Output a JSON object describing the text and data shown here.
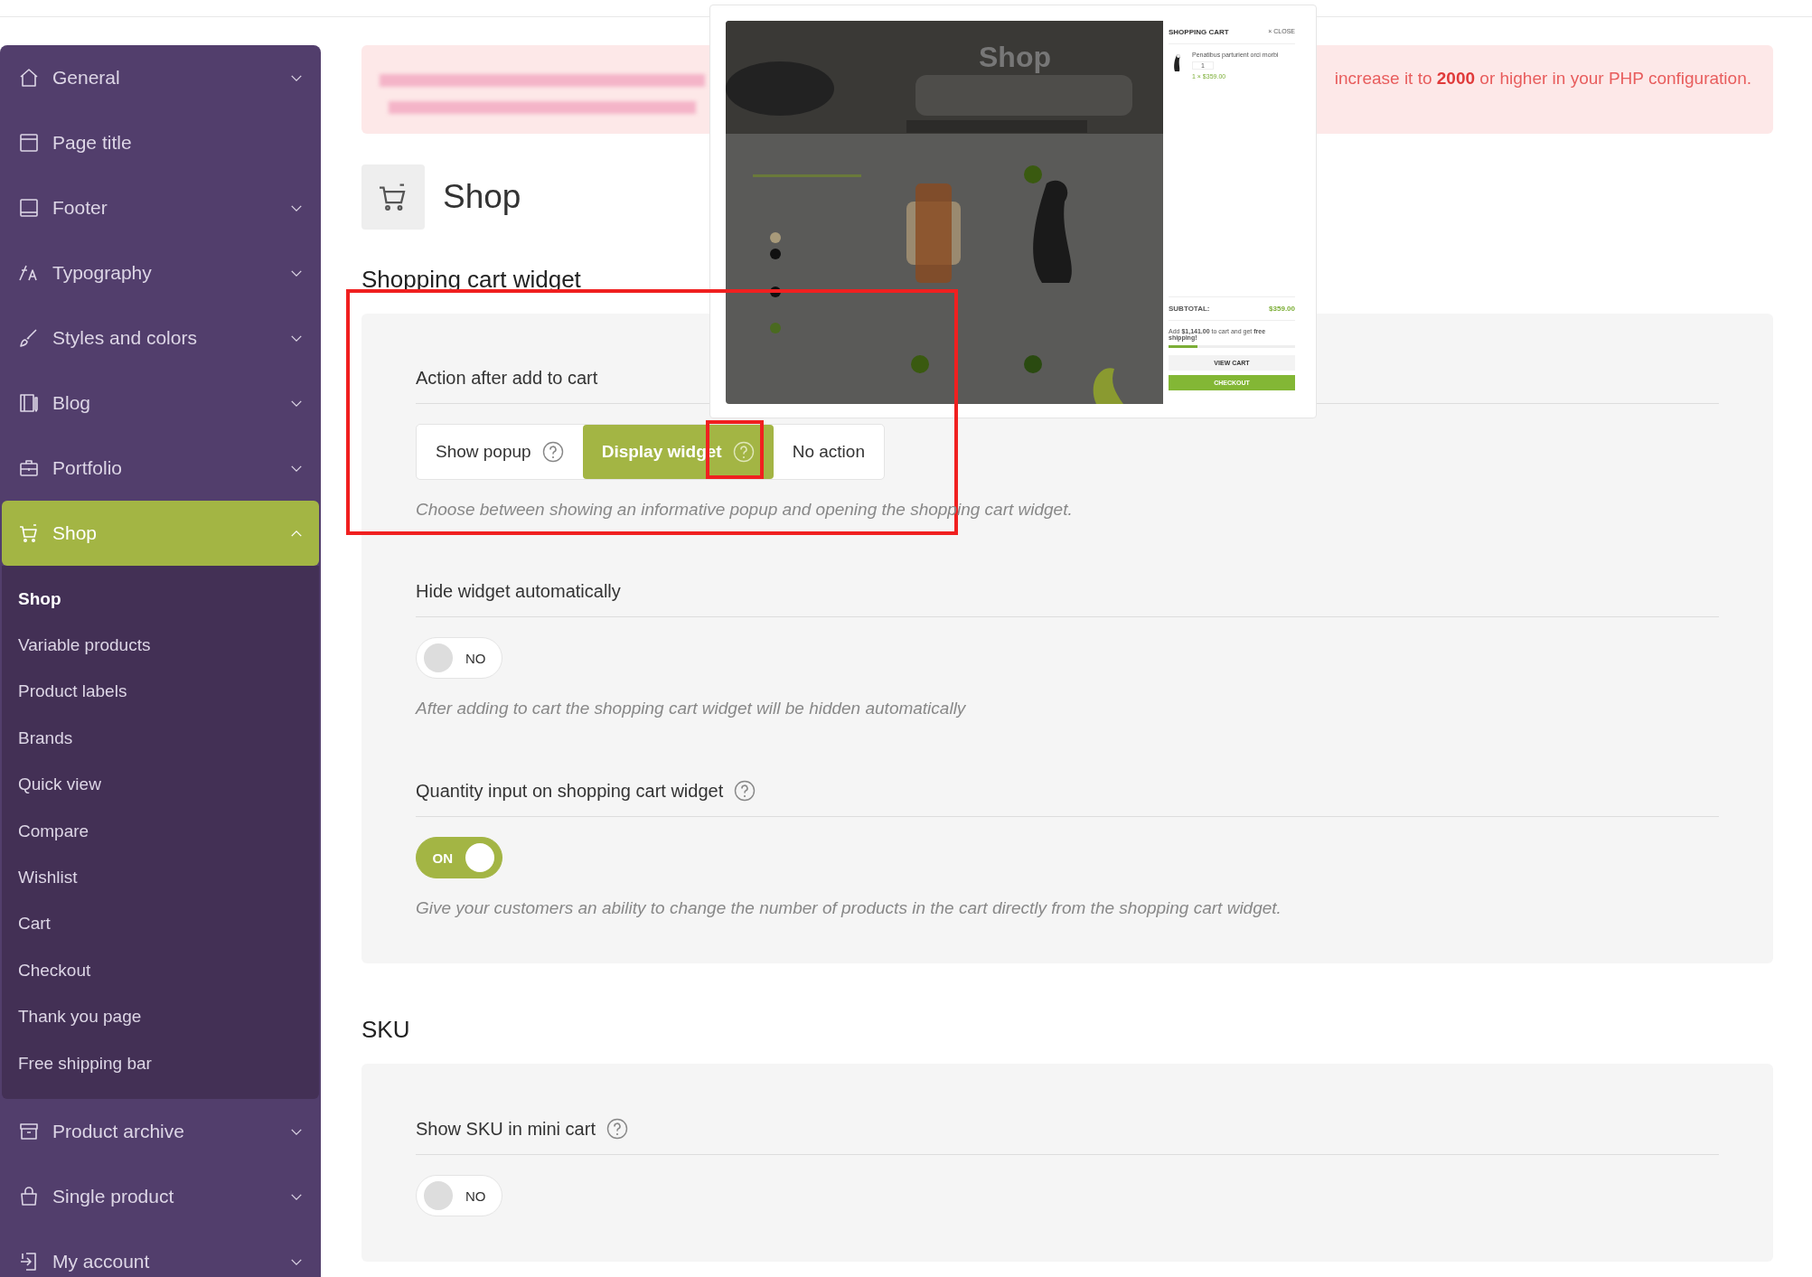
{
  "sidebar": {
    "items": [
      {
        "label": "General",
        "kind": "group",
        "expanded": false,
        "selected": false
      },
      {
        "label": "Page title",
        "kind": "link",
        "selected": false
      },
      {
        "label": "Footer",
        "kind": "group",
        "expanded": false,
        "selected": false
      },
      {
        "label": "Typography",
        "kind": "group",
        "expanded": false,
        "selected": false
      },
      {
        "label": "Styles and colors",
        "kind": "group",
        "expanded": false,
        "selected": false
      },
      {
        "label": "Blog",
        "kind": "group",
        "expanded": false,
        "selected": false
      },
      {
        "label": "Portfolio",
        "kind": "group",
        "expanded": false,
        "selected": false
      },
      {
        "label": "Shop",
        "kind": "group",
        "expanded": true,
        "selected": true,
        "children": [
          {
            "label": "Shop",
            "selected": true
          },
          {
            "label": "Variable products",
            "selected": false
          },
          {
            "label": "Product labels",
            "selected": false
          },
          {
            "label": "Brands",
            "selected": false
          },
          {
            "label": "Quick view",
            "selected": false
          },
          {
            "label": "Compare",
            "selected": false
          },
          {
            "label": "Wishlist",
            "selected": false
          },
          {
            "label": "Cart",
            "selected": false
          },
          {
            "label": "Checkout",
            "selected": false
          },
          {
            "label": "Thank you page",
            "selected": false
          },
          {
            "label": "Free shipping bar",
            "selected": false
          }
        ]
      },
      {
        "label": "Product archive",
        "kind": "group",
        "expanded": false,
        "selected": false
      },
      {
        "label": "Single product",
        "kind": "group",
        "expanded": false,
        "selected": false
      },
      {
        "label": "My account",
        "kind": "group",
        "expanded": false,
        "selected": false
      }
    ]
  },
  "notice": {
    "text": "increase it to **2000** or higher in your PHP configuration."
  },
  "page": {
    "title": "Shop"
  },
  "sections": [
    {
      "heading": "Shopping cart widget",
      "options": [
        {
          "kind": "segmented",
          "label": "Action after add to cart",
          "help": false,
          "choices": [
            {
              "label": "Show popup",
              "help": true,
              "selected": false
            },
            {
              "label": "Display widget",
              "help": true,
              "selected": true
            },
            {
              "label": "No action",
              "help": false,
              "selected": false
            }
          ],
          "description": "Choose between showing an informative popup and opening the shopping cart widget."
        },
        {
          "kind": "toggle",
          "label": "Hide widget automatically",
          "help": false,
          "on": false,
          "state_text": "NO",
          "description": "After adding to cart the shopping cart widget will be hidden automatically"
        },
        {
          "kind": "toggle",
          "label": "Quantity input on shopping cart widget",
          "help": true,
          "on": true,
          "state_text": "ON",
          "description": "Give your customers an ability to change the number of products in the cart directly from the shopping cart widget."
        }
      ]
    },
    {
      "heading": "SKU",
      "options": [
        {
          "kind": "toggle",
          "label": "Show SKU in mini cart",
          "help": true,
          "on": false,
          "state_text": "NO"
        }
      ]
    }
  ],
  "tooltip": {
    "banner_title": "Shop",
    "cart_title": "SHOPPING CART",
    "close": "× CLOSE",
    "product": "Penatibus parturient orci morbi",
    "quantity": "1",
    "price": "1 × $359.00",
    "subtotal_label": "SUBTOTAL:",
    "subtotal": "$359.00",
    "shipping_note": "Add **$1,141.00** to cart and get **free shipping!**",
    "shipping": {
      "level": 0.23
    },
    "view_cart": "VIEW CART",
    "checkout": "CHECKOUT"
  }
}
